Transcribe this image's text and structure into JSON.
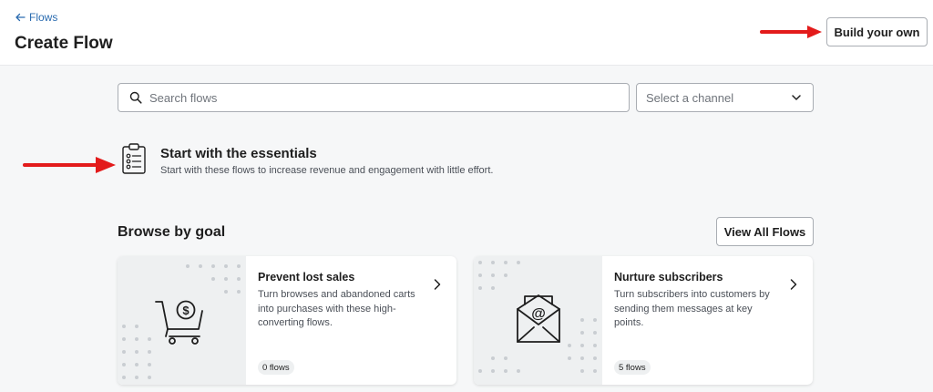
{
  "header": {
    "back_label": "Flows",
    "title": "Create Flow",
    "build_button_label": "Build your own"
  },
  "search": {
    "placeholder": "Search flows",
    "value": ""
  },
  "channel_select": {
    "selected": "Select a channel"
  },
  "essentials": {
    "title": "Start with the essentials",
    "subtitle": "Start with these flows to increase revenue and engagement with little effort."
  },
  "browse": {
    "title": "Browse by goal",
    "view_all_label": "View All Flows",
    "cards": [
      {
        "title": "Prevent lost sales",
        "description": "Turn browses and abandoned carts into purchases with these high-converting flows.",
        "badge": "0 flows",
        "icon": "shopping-cart-dollar-icon"
      },
      {
        "title": "Nurture subscribers",
        "description": "Turn subscribers into customers by sending them messages at key points.",
        "badge": "5 flows",
        "icon": "email-envelope-icon"
      }
    ]
  },
  "colors": {
    "link": "#2b6cb0",
    "annotation_arrow": "#e31b1b",
    "page_background": "#f6f7f8",
    "card_art_background": "#eef0f1"
  }
}
